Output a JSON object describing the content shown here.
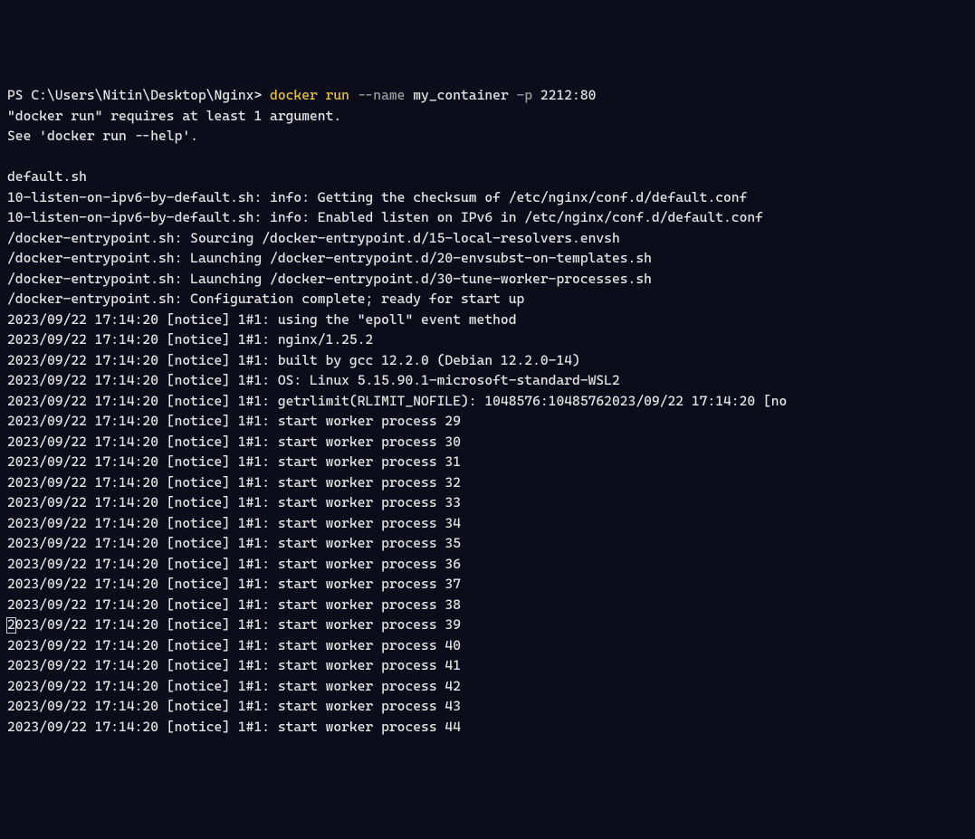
{
  "prompt": {
    "ps": "PS ",
    "path": "C:\\Users\\Nitin\\Desktop\\Nginx> ",
    "cmd_exe": "docker",
    "cmd_sub": " run",
    "cmd_opt1": " --name",
    "cmd_arg1": " my_container",
    "cmd_opt2": " -p",
    "cmd_arg2": " 2212:80"
  },
  "lines": [
    "\"docker run\" requires at least 1 argument.",
    "See 'docker run --help'.",
    "",
    "default.sh",
    "10-listen-on-ipv6-by-default.sh: info: Getting the checksum of /etc/nginx/conf.d/default.conf",
    "10-listen-on-ipv6-by-default.sh: info: Enabled listen on IPv6 in /etc/nginx/conf.d/default.conf",
    "/docker-entrypoint.sh: Sourcing /docker-entrypoint.d/15-local-resolvers.envsh",
    "/docker-entrypoint.sh: Launching /docker-entrypoint.d/20-envsubst-on-templates.sh",
    "/docker-entrypoint.sh: Launching /docker-entrypoint.d/30-tune-worker-processes.sh",
    "/docker-entrypoint.sh: Configuration complete; ready for start up",
    "2023/09/22 17:14:20 [notice] 1#1: using the \"epoll\" event method",
    "2023/09/22 17:14:20 [notice] 1#1: nginx/1.25.2",
    "2023/09/22 17:14:20 [notice] 1#1: built by gcc 12.2.0 (Debian 12.2.0-14)",
    "2023/09/22 17:14:20 [notice] 1#1: OS: Linux 5.15.90.1-microsoft-standard-WSL2",
    "2023/09/22 17:14:20 [notice] 1#1: getrlimit(RLIMIT_NOFILE): 1048576:10485762023/09/22 17:14:20 [no",
    "2023/09/22 17:14:20 [notice] 1#1: start worker process 29",
    "2023/09/22 17:14:20 [notice] 1#1: start worker process 30",
    "2023/09/22 17:14:20 [notice] 1#1: start worker process 31",
    "2023/09/22 17:14:20 [notice] 1#1: start worker process 32",
    "2023/09/22 17:14:20 [notice] 1#1: start worker process 33",
    "2023/09/22 17:14:20 [notice] 1#1: start worker process 34",
    "2023/09/22 17:14:20 [notice] 1#1: start worker process 35",
    "2023/09/22 17:14:20 [notice] 1#1: start worker process 36",
    "2023/09/22 17:14:20 [notice] 1#1: start worker process 37",
    "2023/09/22 17:14:20 [notice] 1#1: start worker process 38",
    "2023/09/22 17:14:20 [notice] 1#1: start worker process 39",
    "2023/09/22 17:14:20 [notice] 1#1: start worker process 40",
    "2023/09/22 17:14:20 [notice] 1#1: start worker process 41",
    "2023/09/22 17:14:20 [notice] 1#1: start worker process 42",
    "2023/09/22 17:14:20 [notice] 1#1: start worker process 43",
    "2023/09/22 17:14:20 [notice] 1#1: start worker process 44"
  ],
  "cursor_line_index": 25
}
